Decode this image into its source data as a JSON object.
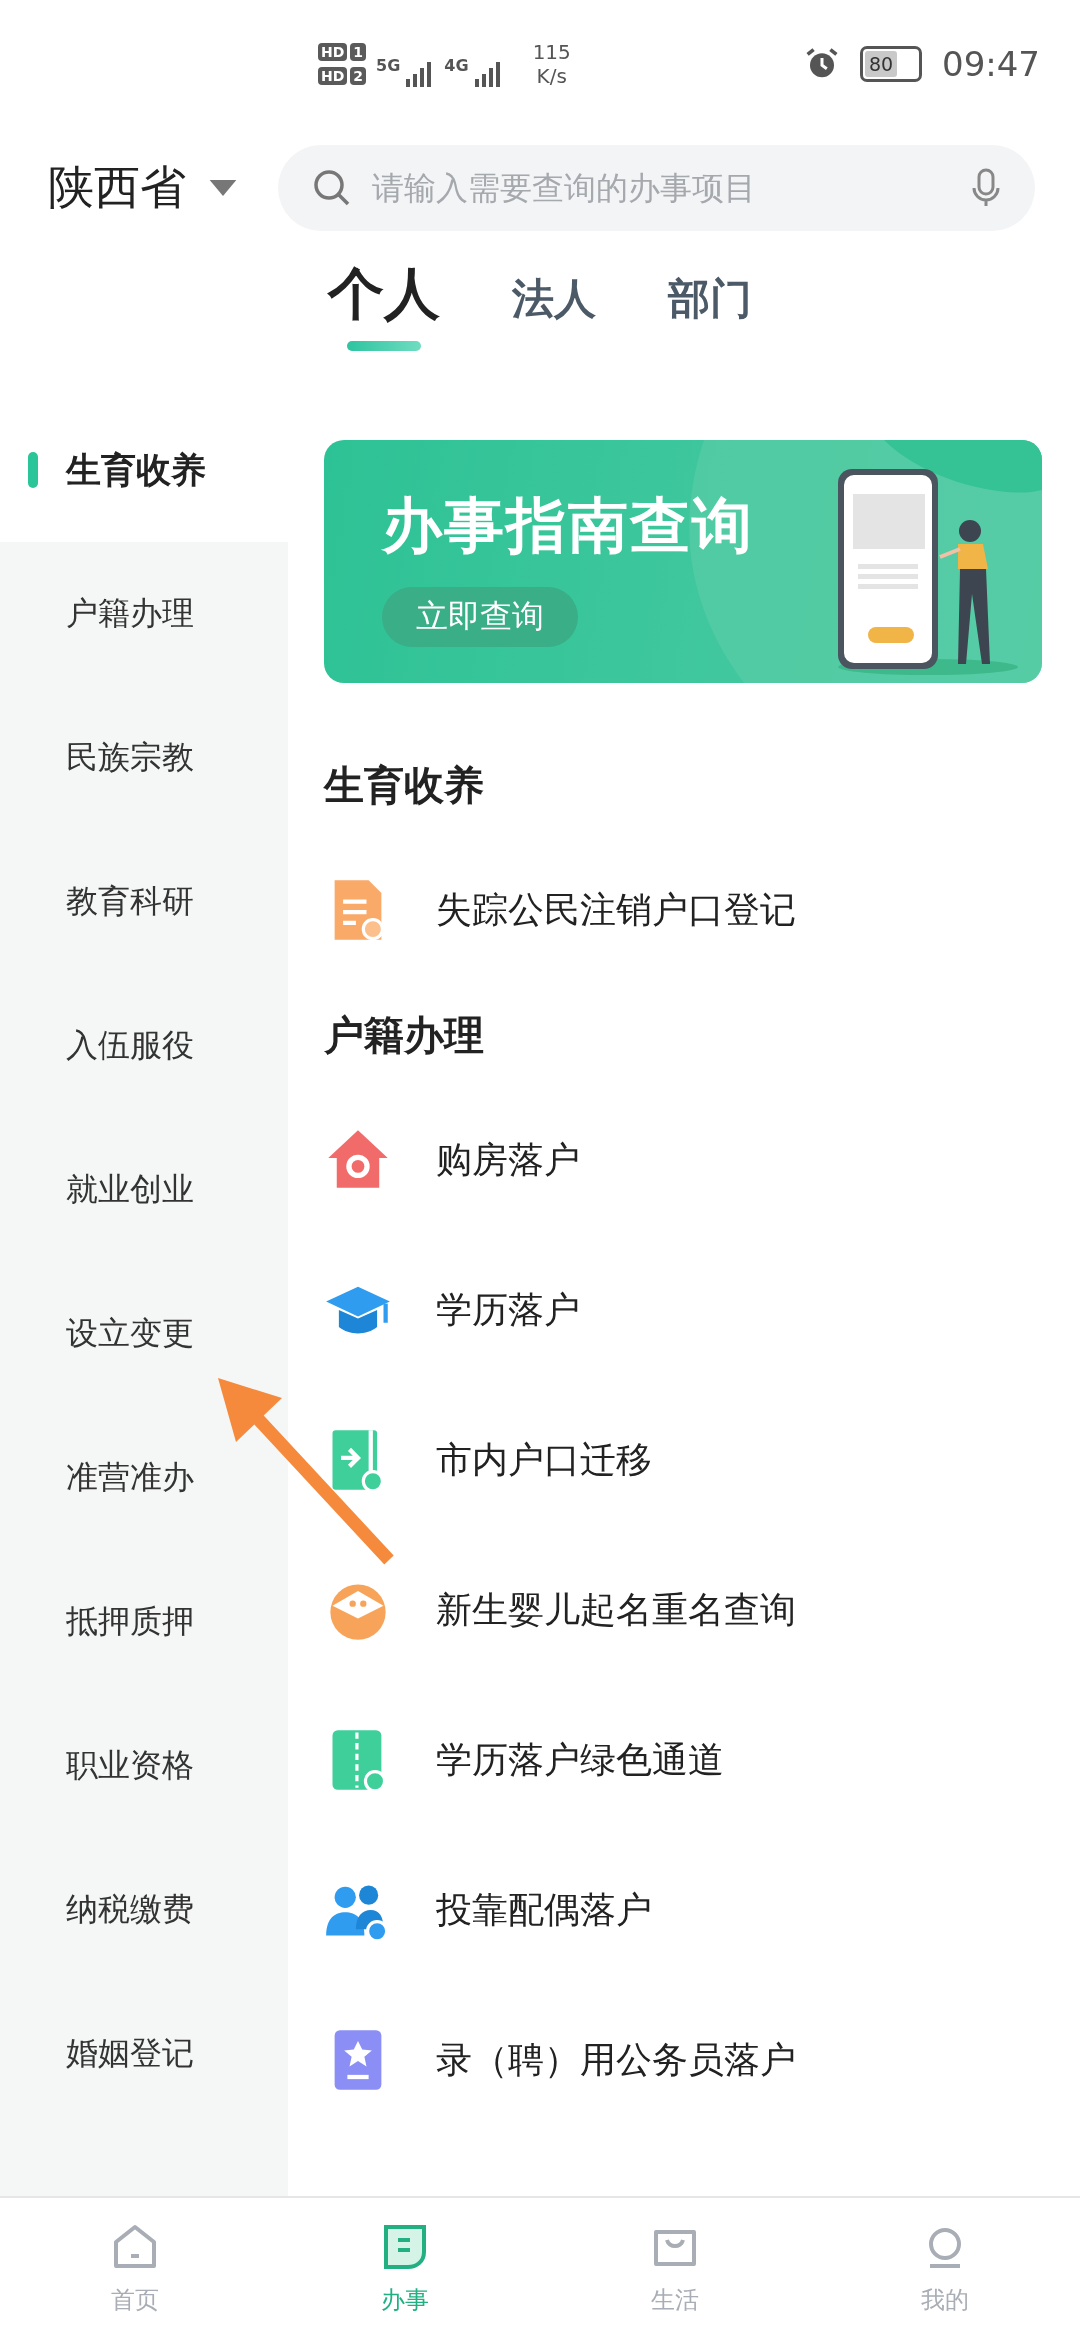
{
  "status_bar": {
    "sims": [
      {
        "label": "HD",
        "slot": "1"
      },
      {
        "label": "HD",
        "slot": "2"
      }
    ],
    "networks": [
      "5G",
      "4G"
    ],
    "speed_value": "115",
    "speed_unit": "K/s",
    "battery": "80",
    "time": "09:47"
  },
  "header": {
    "region": "陕西省",
    "search": {
      "placeholder": "请输入需要查询的办事项目"
    }
  },
  "tabs": [
    {
      "label": "个人",
      "selected": true
    },
    {
      "label": "法人",
      "selected": false
    },
    {
      "label": "部门",
      "selected": false
    }
  ],
  "sidebar": {
    "items": [
      {
        "label": "生育收养",
        "selected": true
      },
      {
        "label": "户籍办理",
        "selected": false
      },
      {
        "label": "民族宗教",
        "selected": false
      },
      {
        "label": "教育科研",
        "selected": false
      },
      {
        "label": "入伍服役",
        "selected": false
      },
      {
        "label": "就业创业",
        "selected": false
      },
      {
        "label": "设立变更",
        "selected": false
      },
      {
        "label": "准营准办",
        "selected": false
      },
      {
        "label": "抵押质押",
        "selected": false
      },
      {
        "label": "职业资格",
        "selected": false
      },
      {
        "label": "纳税缴费",
        "selected": false
      },
      {
        "label": "婚姻登记",
        "selected": false
      }
    ]
  },
  "banner": {
    "title": "办事指南查询",
    "button": "立即查询"
  },
  "sections": [
    {
      "title": "生育收养",
      "items": [
        "失踪公民注销户口登记"
      ]
    },
    {
      "title": "户籍办理",
      "items": [
        "购房落户",
        "学历落户",
        "市内户口迁移",
        "新生婴儿起名重名查询",
        "学历落户绿色通道",
        "投靠配偶落户",
        "录（聘）用公务员落户"
      ]
    }
  ],
  "bottom_nav": [
    {
      "label": "首页",
      "selected": false
    },
    {
      "label": "办事",
      "selected": true
    },
    {
      "label": "生活",
      "selected": false
    },
    {
      "label": "我的",
      "selected": false
    }
  ]
}
